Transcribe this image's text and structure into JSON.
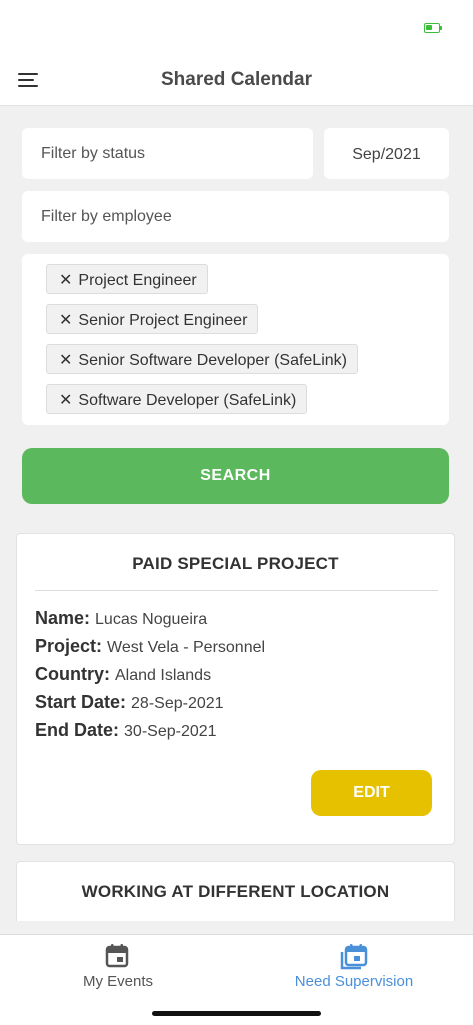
{
  "header": {
    "title": "Shared Calendar"
  },
  "filters": {
    "status_placeholder": "Filter by status",
    "month_value": "Sep/2021",
    "employee_placeholder": "Filter by employee",
    "tags": [
      "Project Engineer",
      "Senior Project Engineer",
      "Senior Software Developer (SafeLink)",
      "Software Developer (SafeLink)"
    ],
    "tag_remove_glyph": "✕"
  },
  "search_label": "SEARCH",
  "events": [
    {
      "title": "PAID SPECIAL PROJECT",
      "fields": [
        {
          "label": "Name:",
          "value": "Lucas Nogueira"
        },
        {
          "label": "Project:",
          "value": "West Vela - Personnel"
        },
        {
          "label": "Country:",
          "value": "Aland Islands"
        },
        {
          "label": "Start Date:",
          "value": "28-Sep-2021"
        },
        {
          "label": "End Date:",
          "value": "30-Sep-2021"
        }
      ],
      "edit_label": "EDIT"
    },
    {
      "title": "WORKING AT DIFFERENT LOCATION"
    }
  ],
  "tab_bar": {
    "items": [
      {
        "label": "My Events",
        "icon": "calendar-icon",
        "active": false
      },
      {
        "label": "Need Supervision",
        "icon": "calendar-stack-icon",
        "active": true
      }
    ]
  },
  "colors": {
    "search_button": "#5cb85c",
    "edit_button": "#e6c100",
    "active_tab": "#4a90d9",
    "inactive_tab": "#555555",
    "battery": "#3bbf3b"
  }
}
